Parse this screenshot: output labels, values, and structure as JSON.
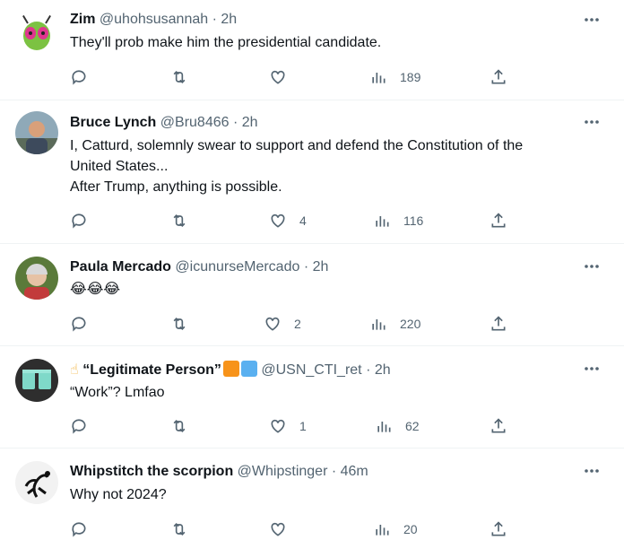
{
  "tweets": [
    {
      "name": "Zim",
      "handle": "@uhohsusannah",
      "time": "2h",
      "lines": [
        "They'll prob make him the presidential candidate."
      ],
      "likes": "",
      "views": "189"
    },
    {
      "name": "Bruce Lynch",
      "handle": "@Bru8466",
      "time": "2h",
      "lines": [
        "I, Catturd, solemnly swear to support and defend the Constitution of the",
        "United States...",
        "After Trump, anything is possible."
      ],
      "likes": "4",
      "views": "116"
    },
    {
      "name": "Paula Mercado",
      "handle": "@icunurseMercado",
      "time": "2h",
      "lines": [
        "😂😂😂"
      ],
      "likes": "2",
      "views": "220"
    },
    {
      "name_prefix": "☝",
      "name": "“Legitimate Person”",
      "handle": "@USN_CTI_ret",
      "time": "2h",
      "lines": [
        "“Work”? Lmfao"
      ],
      "likes": "1",
      "views": "62"
    },
    {
      "name": "Whipstitch the scorpion",
      "handle": "@Whipstinger",
      "time": "46m",
      "lines": [
        "Why not 2024?"
      ],
      "likes": "",
      "views": "20"
    }
  ],
  "separator": "·",
  "colors": {
    "secondary": "#536471",
    "divider": "#eff3f4",
    "badge_orange": "#f7931a",
    "badge_blue": "#5ab0f0"
  },
  "icons": {
    "reply": "reply-icon",
    "retweet": "retweet-icon",
    "like": "heart-icon",
    "views": "views-icon",
    "share": "share-icon",
    "more": "more-icon"
  }
}
